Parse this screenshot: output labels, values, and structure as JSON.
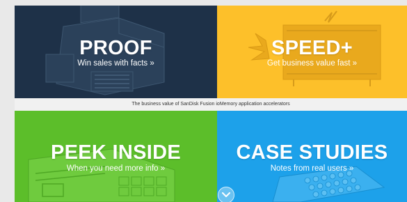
{
  "tiles": {
    "proof": {
      "title": "PROOF",
      "subtitle": "Win sales with facts »",
      "color": "#1e3148"
    },
    "speed": {
      "title": "SPEED+",
      "subtitle": "Get business value fast »",
      "color": "#fdc02a"
    },
    "peek": {
      "title": "PEEK INSIDE",
      "subtitle": "When you need more info »",
      "color": "#5cbe2a"
    },
    "case": {
      "title": "CASE STUDIES",
      "subtitle": "Notes from real users »",
      "color": "#1da1ea"
    }
  },
  "caption": "The business value of SanDisk Fusion ioMemory application accelerators",
  "scroll_button": {
    "icon": "chevron-down-icon"
  }
}
